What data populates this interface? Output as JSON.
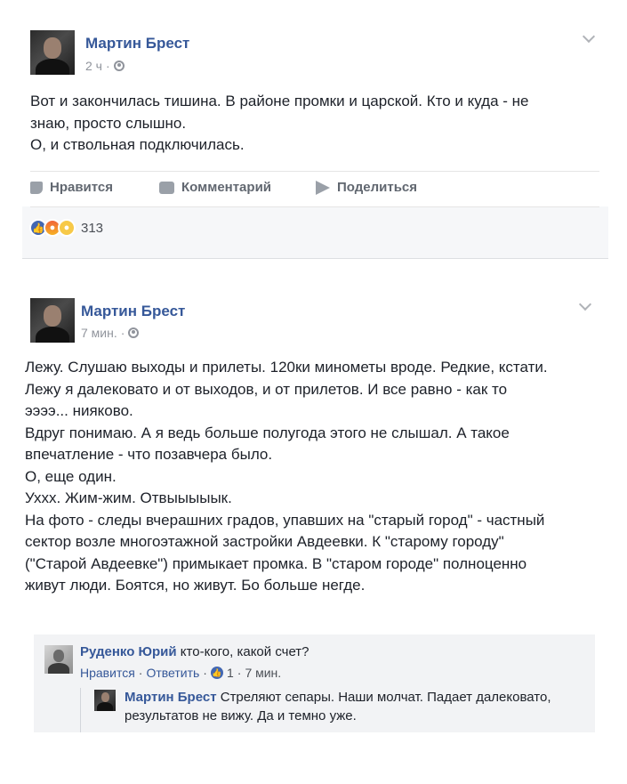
{
  "post1": {
    "author": "Мартин Брест",
    "time": "2 ч",
    "dot": "·",
    "text": "Вот и закончилась тишина. В районе промки и царской. Кто и куда - не\nзнаю, просто слышно.\nО, и ствольная подключилась.",
    "actions": {
      "like": "Нравится",
      "comment": "Комментарий",
      "share": "Поделиться"
    },
    "reactions_count": "313",
    "reactions": [
      "like-icon",
      "angry-icon",
      "sad-icon"
    ]
  },
  "post2": {
    "author": "Мартин Брест",
    "time": "7 мин.",
    "dot": "·",
    "text": "Лежу. Слушаю выходы и прилеты. 120ки минометы вроде. Редкие, кстати.\nЛежу я далековато и от выходов, и от прилетов. И все равно - как то\nээээ... нияково.\nВдруг понимаю. А я ведь больше полугода этого не слышал. А такое\nвпечатление - что позавчера было.\nО, еще один.\nУххх. Жим-жим. Отвыыыыык.\nНа фото - следы вчерашних градов, упавших на \"старый город\" - частный\nсектор возле многоэтажной застройки Авдеевки. К \"старому городу\"\n(\"Старой Авдеевке\") примыкает промка. В \"старом городе\" полноценно\nживут люди. Боятся, но живут. Бо больше негде."
  },
  "comments": [
    {
      "author": "Руденко Юрий",
      "text": "кто-кого, какой счет?",
      "like_label": "Нравится",
      "reply_label": "Ответить",
      "sep": "·",
      "likes": "1",
      "time": "7 мин."
    },
    {
      "author": "Мартин Брест",
      "text_line1": "Стреляют сепары. Наши молчат. Падает далековато,",
      "text_line2": "результатов не вижу. Да и темно уже."
    }
  ],
  "colors": {
    "link": "#365899",
    "meta": "#90949c",
    "fb_blue": "#4267b2"
  }
}
